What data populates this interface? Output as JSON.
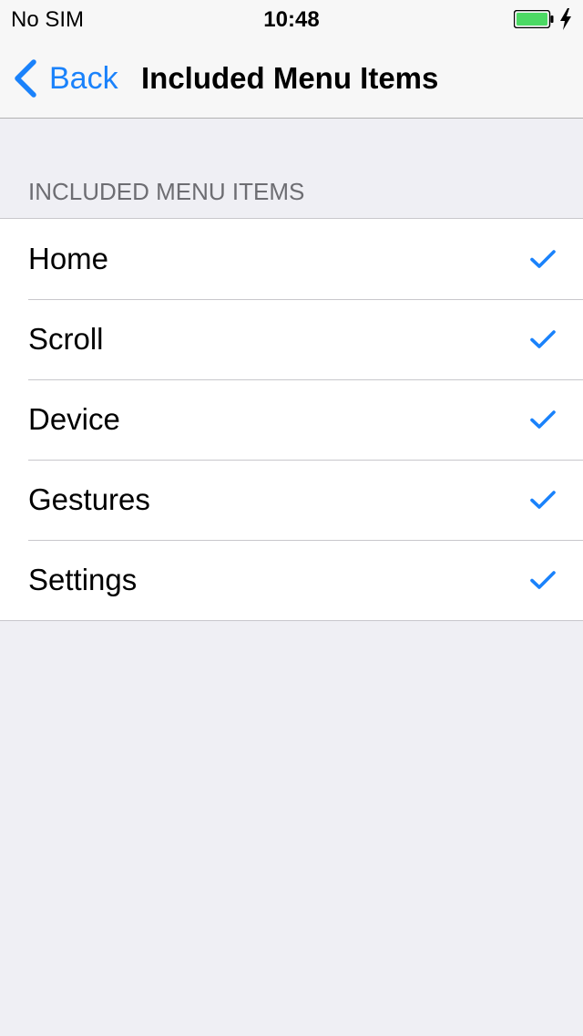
{
  "status_bar": {
    "carrier": "No SIM",
    "time": "10:48",
    "battery_color": "#4cd964"
  },
  "nav": {
    "back_label": "Back",
    "title": "Included Menu Items"
  },
  "section": {
    "header": "INCLUDED MENU ITEMS",
    "items": [
      {
        "label": "Home",
        "checked": true
      },
      {
        "label": "Scroll",
        "checked": true
      },
      {
        "label": "Device",
        "checked": true
      },
      {
        "label": "Gestures",
        "checked": true
      },
      {
        "label": "Settings",
        "checked": true
      }
    ]
  },
  "colors": {
    "accent": "#1a82fb",
    "background": "#efeff4"
  },
  "icons": {
    "back": "chevron-left-icon",
    "check": "checkmark-icon",
    "battery": "battery-icon",
    "charging": "charging-bolt-icon"
  }
}
